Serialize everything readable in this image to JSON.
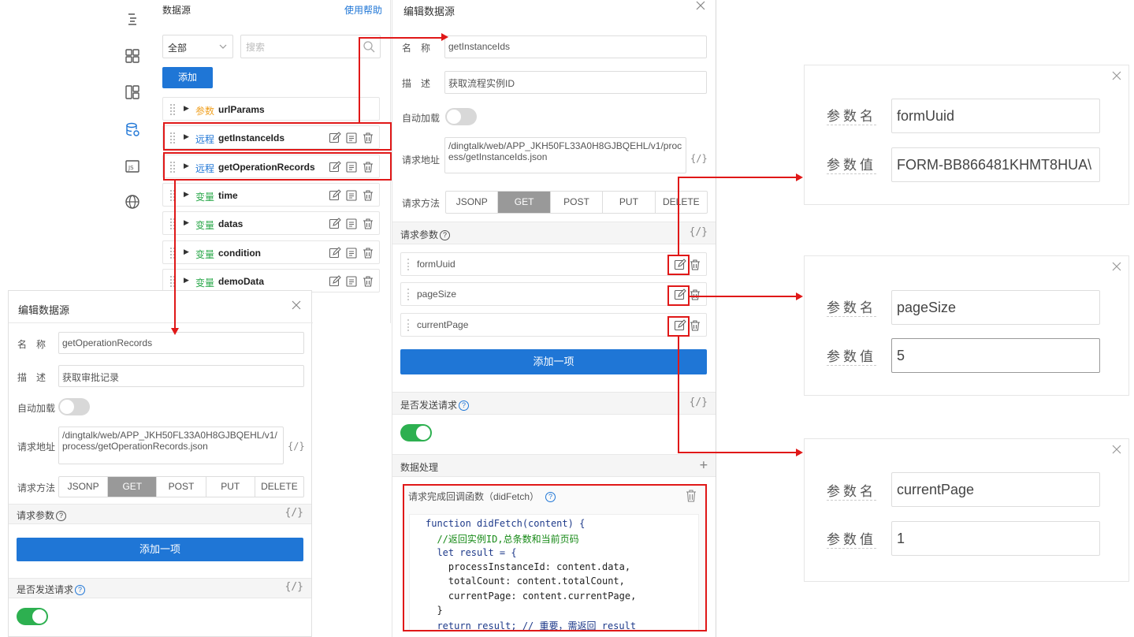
{
  "rail": {
    "icons": [
      "outline-icon",
      "components-icon",
      "layout-icon",
      "datasource-icon",
      "js-icon",
      "globe-icon"
    ]
  },
  "datasource_panel": {
    "title": "数据源",
    "help_link": "使用帮助",
    "filter_value": "全部",
    "search_placeholder": "搜索",
    "add_button": "添加",
    "items": [
      {
        "type": "参数",
        "name": "urlParams",
        "type_color": "#f0a020"
      },
      {
        "type": "远程",
        "name": "getInstanceIds",
        "type_color": "#1f76d6"
      },
      {
        "type": "远程",
        "name": "getOperationRecords",
        "type_color": "#1f76d6"
      },
      {
        "type": "变量",
        "name": "time",
        "type_color": "#2aa84a"
      },
      {
        "type": "变量",
        "name": "datas",
        "type_color": "#2aa84a"
      },
      {
        "type": "变量",
        "name": "condition",
        "type_color": "#2aa84a"
      },
      {
        "type": "变量",
        "name": "demoData",
        "type_color": "#2aa84a"
      }
    ]
  },
  "main_editor": {
    "title": "编辑数据源",
    "name_label": "名　称",
    "name_value": "getInstanceIds",
    "desc_label": "描　述",
    "desc_value": "获取流程实例ID",
    "autoload_label": "自动加载",
    "url_label": "请求地址",
    "url_value": "/dingtalk/web/APP_JKH50FL33A0H8GJBQEHL/v1/process/getInstanceIds.json",
    "url_code_btn": "{/}",
    "method_label": "请求方法",
    "methods": [
      "JSONP",
      "GET",
      "POST",
      "PUT",
      "DELETE"
    ],
    "method_selected": "GET",
    "params_label": "请求参数",
    "params_code_btn": "{/}",
    "params": [
      "formUuid",
      "pageSize",
      "currentPage"
    ],
    "add_item_button": "添加一项",
    "send_label": "是否发送请求",
    "send_code_btn": "{/}",
    "data_handling_label": "数据处理",
    "data_handling_add": "+",
    "callback_label": "请求完成回调函数（didFetch）",
    "code_lines": [
      "function didFetch(content) {",
      "  //返回实例ID,总条数和当前页码",
      "  let result = {",
      "    processInstanceId: content.data,",
      "    totalCount: content.totalCount,",
      "    currentPage: content.currentPage,",
      "  }",
      "  return result; // 重要，需返回 result"
    ]
  },
  "small_editor": {
    "title": "编辑数据源",
    "name_label": "名　称",
    "name_value": "getOperationRecords",
    "desc_label": "描　述",
    "desc_value": "获取审批记录",
    "autoload_label": "自动加载",
    "url_label": "请求地址",
    "url_value": "/dingtalk/web/APP_JKH50FL33A0H8GJBQEHL/v1/process/getOperationRecords.json",
    "url_code_btn": "{/}",
    "method_label": "请求方法",
    "methods": [
      "JSONP",
      "GET",
      "POST",
      "PUT",
      "DELETE"
    ],
    "method_selected": "GET",
    "params_label": "请求参数",
    "params_code_btn": "{/}",
    "add_item_button": "添加一项",
    "send_label": "是否发送请求",
    "send_code_btn": "{/}"
  },
  "param_dialogs": [
    {
      "name_label": "参数名",
      "name_value": "formUuid",
      "value_label": "参数值",
      "value": "FORM-BB866481KHMT8HUA\\"
    },
    {
      "name_label": "参数名",
      "name_value": "pageSize",
      "value_label": "参数值",
      "value": "5"
    },
    {
      "name_label": "参数名",
      "name_value": "currentPage",
      "value_label": "参数值",
      "value": "1"
    }
  ],
  "colors": {
    "accent": "#1f76d6",
    "toggle_on": "#2db050",
    "annotation": "#e01818"
  }
}
